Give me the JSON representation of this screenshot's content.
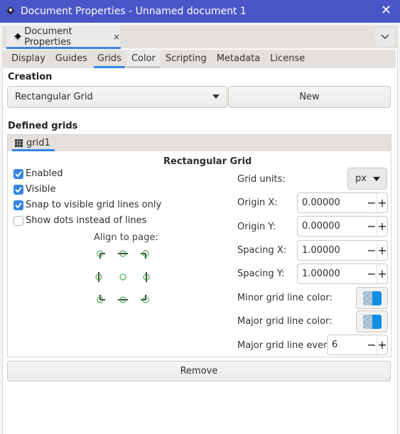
{
  "window": {
    "title": "Document Properties - Unnamed document 1",
    "close_icon": "close-icon"
  },
  "dock": {
    "tab_label": "Document Properties",
    "tab_close": "×",
    "menu_icon": "chevron-down-icon"
  },
  "tabs": [
    {
      "label": "Display",
      "state": "normal"
    },
    {
      "label": "Guides",
      "state": "normal"
    },
    {
      "label": "Grids",
      "state": "active"
    },
    {
      "label": "Color",
      "state": "hover"
    },
    {
      "label": "Scripting",
      "state": "normal"
    },
    {
      "label": "Metadata",
      "state": "normal"
    },
    {
      "label": "License",
      "state": "normal"
    }
  ],
  "creation": {
    "heading": "Creation",
    "grid_type_selected": "Rectangular Grid",
    "new_button": "New"
  },
  "defined": {
    "heading": "Defined grids",
    "grid_tab": "grid1",
    "grid_title": "Rectangular Grid",
    "checkboxes": [
      {
        "label": "Enabled",
        "checked": true
      },
      {
        "label": "Visible",
        "checked": true
      },
      {
        "label": "Snap to visible grid lines only",
        "checked": true
      },
      {
        "label": "Show dots instead of lines",
        "checked": false
      }
    ],
    "align_label": "Align to page:",
    "align_positions": [
      "top-left",
      "top-center",
      "top-right",
      "middle-left",
      "center",
      "middle-right",
      "bottom-left",
      "bottom-center",
      "bottom-right"
    ],
    "grid_units_label": "Grid units:",
    "grid_units_value": "px",
    "origin_x_label": "Origin X:",
    "origin_x": "0.00000",
    "origin_y_label": "Origin Y:",
    "origin_y": "0.00000",
    "spacing_x_label": "Spacing X:",
    "spacing_x": "1.00000",
    "spacing_y_label": "Spacing Y:",
    "spacing_y": "1.00000",
    "minor_color_label": "Minor grid line color:",
    "minor_color": "#0f8ee6",
    "major_color_label": "Major grid line color:",
    "major_color": "#0f8ee6",
    "major_every_label": "Major grid line every:",
    "major_every": "6",
    "minus": "−",
    "plus": "+"
  },
  "remove_button": "Remove"
}
